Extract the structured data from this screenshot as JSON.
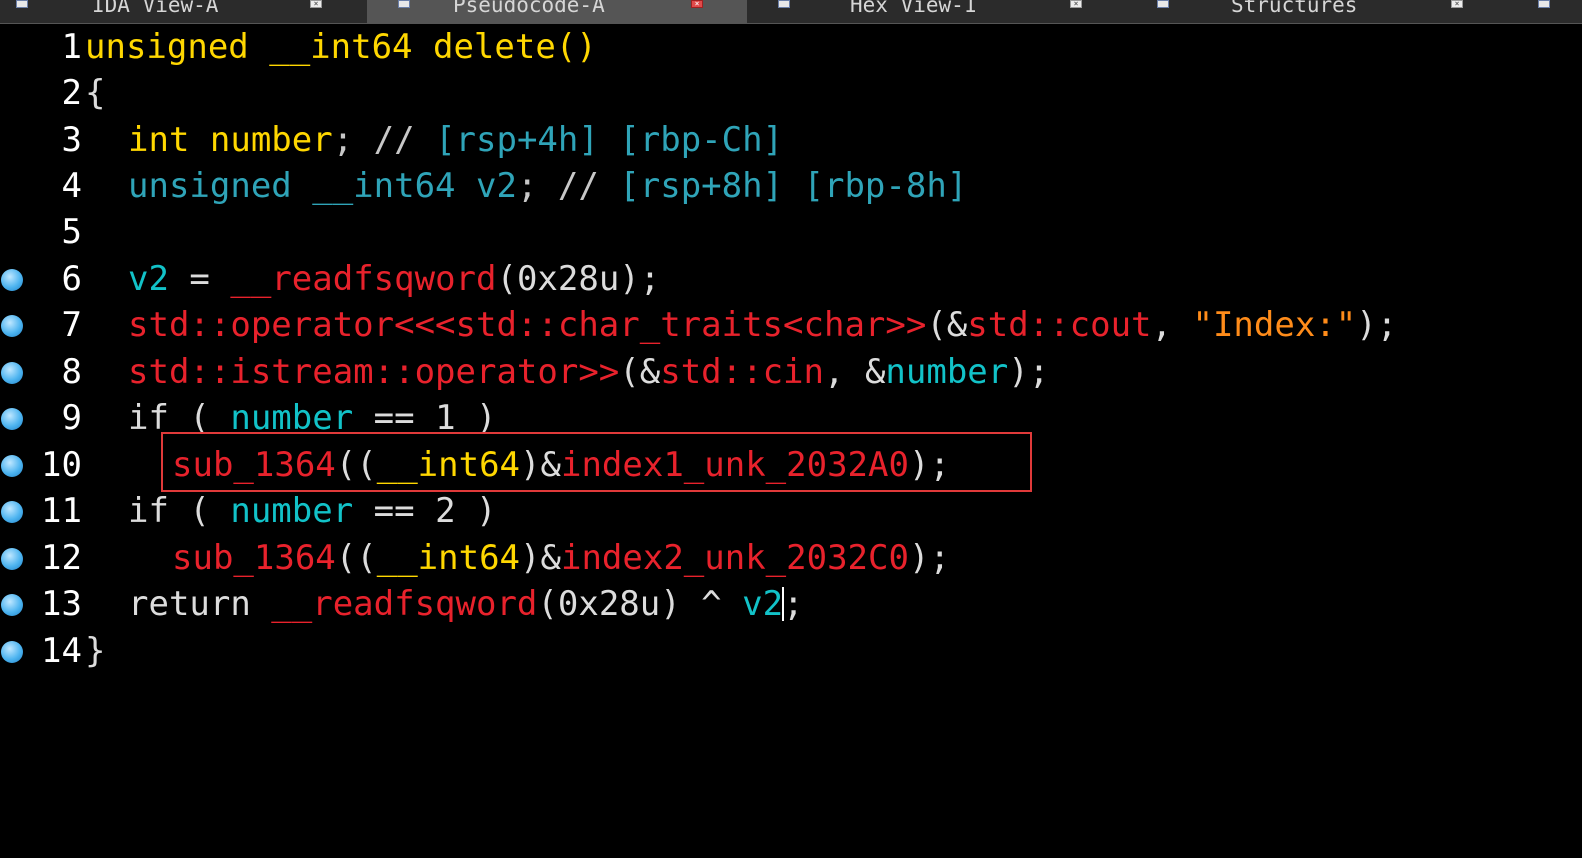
{
  "tabs": [
    {
      "label": "IDA View-A",
      "active": false,
      "icon": "disassembly-icon"
    },
    {
      "label": "Pseudocode-A",
      "active": true,
      "icon": "pseudocode-icon"
    },
    {
      "label": "Hex View-1",
      "active": false,
      "icon": "hex-icon"
    },
    {
      "label": "Structures",
      "active": false,
      "icon": "structures-icon"
    }
  ],
  "colors": {
    "background": "#000000",
    "keyword_type": "#2fa4b8",
    "function": "#e8222c",
    "variable": "#12c2c8",
    "string": "#ff8c1a",
    "highlight_box": "#e03a3a"
  },
  "code": {
    "lines": [
      {
        "num": "1",
        "breakpoint": false,
        "tokens": {
          "t1": "unsigned __int64 delete()"
        }
      },
      {
        "num": "2",
        "breakpoint": false,
        "tokens": {
          "t1": "{"
        }
      },
      {
        "num": "3",
        "breakpoint": false,
        "tokens": {
          "t1": "int number",
          "t2": "; // ",
          "t3": "[rsp+4h] [rbp-Ch]"
        }
      },
      {
        "num": "4",
        "breakpoint": false,
        "tokens": {
          "t1": "unsigned __int64 v2",
          "t2": "; // ",
          "t3": "[rsp+8h] [rbp-8h]"
        }
      },
      {
        "num": "5",
        "breakpoint": false,
        "tokens": {}
      },
      {
        "num": "6",
        "breakpoint": true,
        "tokens": {
          "t1": "v2",
          "t2": " = ",
          "t3": "__readfsqword",
          "t4": "(0x28u);"
        }
      },
      {
        "num": "7",
        "breakpoint": true,
        "tokens": {
          "t1": "std::operator<<<std::char_traits<char>>",
          "t2": "(&",
          "t3": "std::cout",
          "t4": ", ",
          "t5": "\"Index:\"",
          "t6": ");"
        }
      },
      {
        "num": "8",
        "breakpoint": true,
        "tokens": {
          "t1": "std::istream::operator>>",
          "t2": "(&",
          "t3": "std::cin",
          "t4": ", &",
          "t5": "number",
          "t6": ");"
        }
      },
      {
        "num": "9",
        "breakpoint": true,
        "tokens": {
          "t1": "if ( ",
          "t2": "number",
          "t3": " == 1 )"
        }
      },
      {
        "num": "10",
        "breakpoint": true,
        "tokens": {
          "t1": "sub_1364",
          "t2": "((",
          "t3": "__int64",
          "t4": ")&",
          "t5": "index1_unk_2032A0",
          "t6": ");"
        }
      },
      {
        "num": "11",
        "breakpoint": true,
        "tokens": {
          "t1": "if ( ",
          "t2": "number",
          "t3": " == 2 )"
        }
      },
      {
        "num": "12",
        "breakpoint": true,
        "tokens": {
          "t1": "sub_1364",
          "t2": "((",
          "t3": "__int64",
          "t4": ")&",
          "t5": "index2_unk_2032C0",
          "t6": ");"
        }
      },
      {
        "num": "13",
        "breakpoint": true,
        "tokens": {
          "t1": "return ",
          "t2": "__readfsqword",
          "t3": "(0x28u) ^ ",
          "t4": "v2",
          "t5": ";"
        }
      },
      {
        "num": "14",
        "breakpoint": true,
        "tokens": {
          "t1": "}"
        }
      }
    ]
  }
}
